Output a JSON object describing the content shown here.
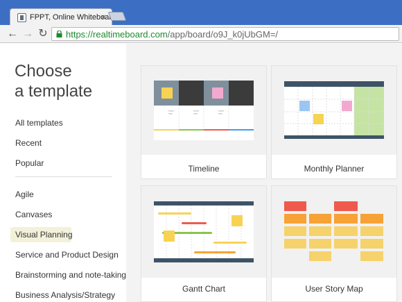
{
  "browser": {
    "tab_title": "FPPT, Online Whiteboard",
    "tab_close": "×",
    "url_scheme": "https://",
    "url_host": "realtimeboard.com",
    "url_path": "/app/board/o9J_k0jUbGM=/"
  },
  "sidebar": {
    "heading_line1": "Choose",
    "heading_line2": "a template",
    "primary_items": [
      "All templates",
      "Recent",
      "Popular"
    ],
    "category_items": [
      "Agile",
      "Canvases",
      "Visual Planning",
      "Service and Product Design",
      "Brainstorming and note-taking",
      "Business Analysis/Strategy"
    ],
    "active_item": "Visual Planning"
  },
  "templates": [
    {
      "label": "Timeline"
    },
    {
      "label": "Monthly Planner"
    },
    {
      "label": "Gantt Chart"
    },
    {
      "label": "User Story Map"
    }
  ],
  "colors": {
    "chrome_blue": "#3c6fc4",
    "sticky_yellow": "#f7d353",
    "sticky_pink": "#f3a9cf",
    "sticky_blue": "#9cc6f2",
    "planner_green": "#c5e4a4",
    "story_red": "#ef5a4d",
    "story_orange": "#f7a236",
    "story_yellow": "#f6d26d",
    "dark_slate": "#3e5366"
  }
}
